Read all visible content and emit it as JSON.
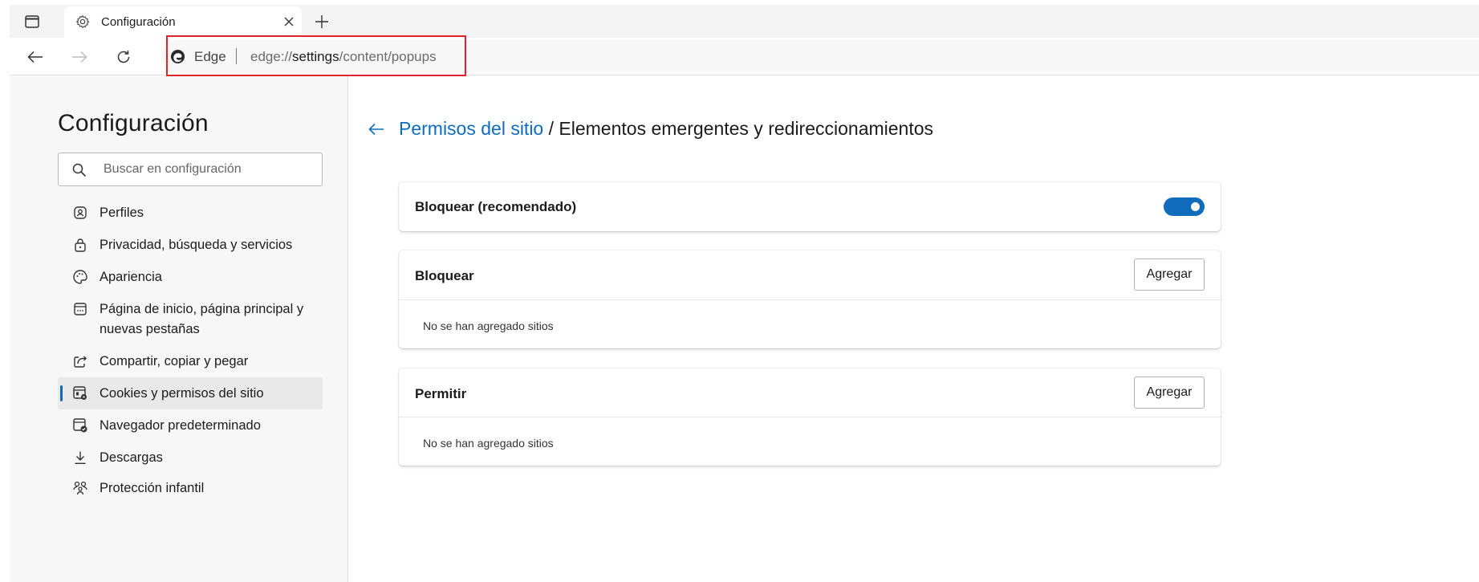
{
  "tab": {
    "title": "Configuración"
  },
  "address_bar": {
    "brand": "Edge",
    "url_scheme": "edge://",
    "url_host": "settings",
    "url_path": "/content/popups"
  },
  "sidebar": {
    "title": "Configuración",
    "search_placeholder": "Buscar en configuración",
    "items": [
      {
        "label": "Perfiles",
        "icon": "profile-icon"
      },
      {
        "label": "Privacidad, búsqueda y servicios",
        "icon": "lock-icon"
      },
      {
        "label": "Apariencia",
        "icon": "palette-icon"
      },
      {
        "label_line1": "Página de inicio, página principal y",
        "label_line2": "nuevas pestañas",
        "icon": "home-page-icon"
      },
      {
        "label": "Compartir, copiar y pegar",
        "icon": "share-icon"
      },
      {
        "label": "Cookies y permisos del sitio",
        "icon": "site-permissions-icon",
        "selected": true
      },
      {
        "label": "Navegador predeterminado",
        "icon": "default-browser-icon"
      },
      {
        "label": "Descargas",
        "icon": "download-icon"
      },
      {
        "label": "Protección infantil",
        "icon": "family-icon"
      }
    ]
  },
  "main": {
    "breadcrumb_link": "Permisos del sitio",
    "breadcrumb_separator": " / ",
    "breadcrumb_current": "Elementos emergentes y redireccionamientos",
    "block_recommended": {
      "label": "Bloquear (recomendado)",
      "enabled": true
    },
    "block_section": {
      "label": "Bloquear",
      "button": "Agregar",
      "empty": "No se han agregado sitios"
    },
    "allow_section": {
      "label": "Permitir",
      "button": "Agregar",
      "empty": "No se han agregado sitios"
    }
  },
  "colors": {
    "accent": "#0f6cbd",
    "highlight_box": "#e0242a",
    "sidebar_bg": "#f7f7f7"
  }
}
